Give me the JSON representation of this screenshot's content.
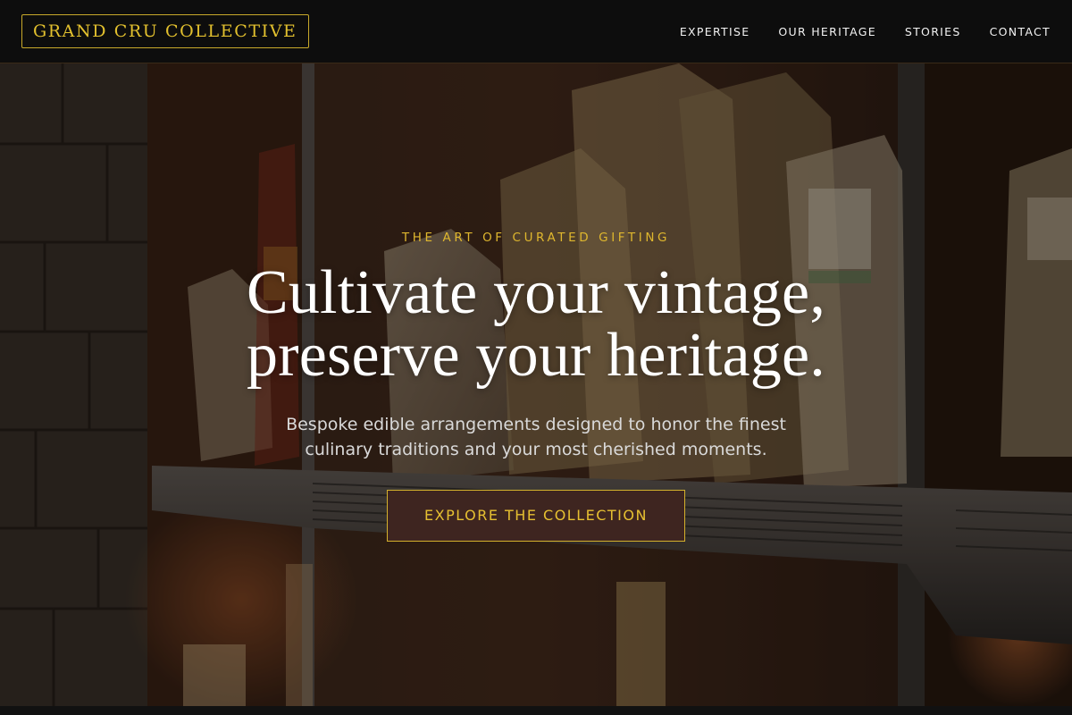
{
  "header": {
    "brand": "GRAND CRU COLLECTIVE",
    "nav": [
      {
        "label": "EXPERTISE"
      },
      {
        "label": "OUR HERITAGE"
      },
      {
        "label": "STORIES"
      },
      {
        "label": "CONTACT"
      }
    ]
  },
  "hero": {
    "eyebrow": "THE ART OF CURATED GIFTING",
    "headline_line1": "Cultivate your vintage,",
    "headline_line2": "preserve your heritage.",
    "subtext": "Bespoke edible arrangements designed to honor the finest culinary traditions and your most cherished moments.",
    "cta_label": "EXPLORE THE COLLECTION",
    "photo_alt": "Pantry shelves stocked with bags of artisanal pasta"
  },
  "colors": {
    "accent_gold": "#e2c02e",
    "header_bg": "#0d0d0d",
    "cta_bg": "#3e2520"
  }
}
